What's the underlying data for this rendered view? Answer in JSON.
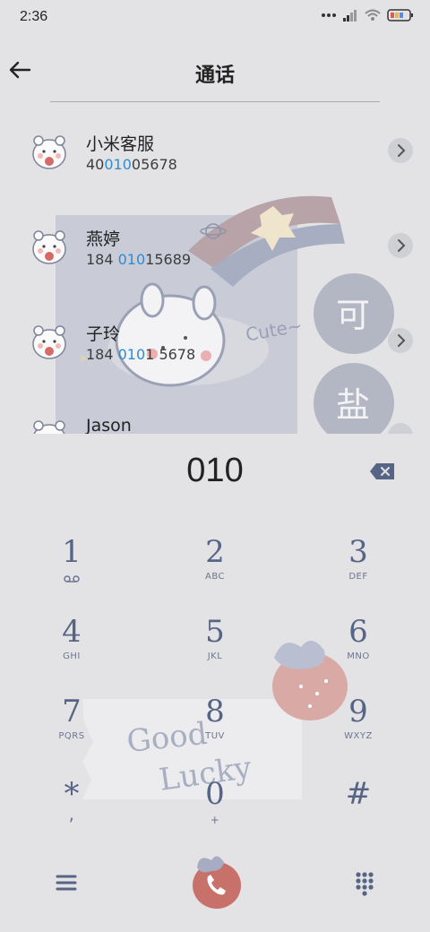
{
  "status": {
    "time": "2:36"
  },
  "header": {
    "title": "通话"
  },
  "contacts": [
    {
      "name": "小米客服",
      "num_a": "40",
      "num_hl": "010",
      "num_b": "05678"
    },
    {
      "name": "燕婷",
      "num_a": "184 ",
      "num_hl": "010",
      "num_b": "15689"
    },
    {
      "name": "子玲",
      "num_a": "184 ",
      "num_hl": "010",
      "num_b": "1 5678"
    },
    {
      "name": "Jason",
      "num_a": "",
      "num_hl": "",
      "num_b": ""
    }
  ],
  "sticker": {
    "text": "Cute~",
    "chip1": "可",
    "chip2": "盐"
  },
  "dialer": {
    "number": "010",
    "keys": [
      {
        "digit": "1",
        "letters": ""
      },
      {
        "digit": "2",
        "letters": "ABC"
      },
      {
        "digit": "3",
        "letters": "DEF"
      },
      {
        "digit": "4",
        "letters": "GHI"
      },
      {
        "digit": "5",
        "letters": "JKL"
      },
      {
        "digit": "6",
        "letters": "MNO"
      },
      {
        "digit": "7",
        "letters": "PQRS"
      },
      {
        "digit": "8",
        "letters": "TUV"
      },
      {
        "digit": "9",
        "letters": "WXYZ"
      },
      {
        "digit": "*",
        "letters": ","
      },
      {
        "digit": "0",
        "letters": "+"
      },
      {
        "digit": "#",
        "letters": ""
      }
    ]
  },
  "decor": {
    "note_line1": "Good",
    "note_line2": "Lucky"
  },
  "colors": {
    "accent": "#2d8cd6",
    "key": "#566485",
    "call": "#c8706a"
  }
}
